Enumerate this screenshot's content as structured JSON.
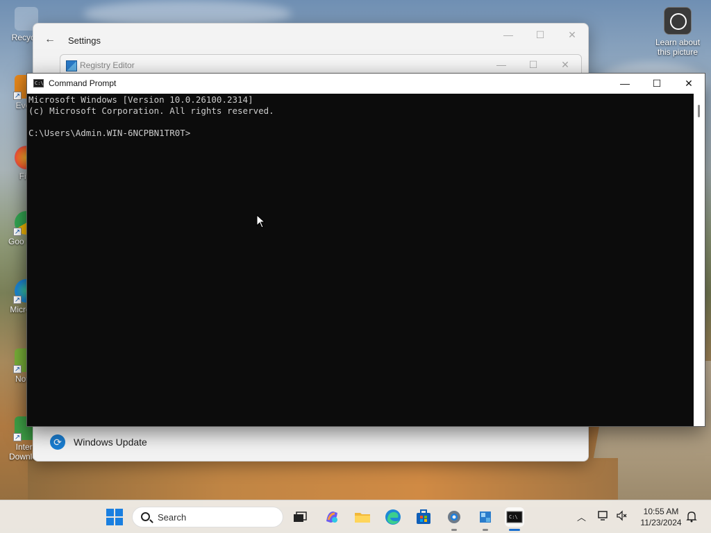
{
  "desktop": {
    "icons": [
      {
        "label": "Recycle",
        "icon": "recycle-bin-icon"
      },
      {
        "label": "Every",
        "icon": "everything-icon"
      },
      {
        "label": "Fire",
        "icon": "firefox-icon"
      },
      {
        "label": "Goo Chro",
        "icon": "chrome-icon"
      },
      {
        "label": "Micro Ed",
        "icon": "edge-icon"
      },
      {
        "label": "Notep",
        "icon": "notepad-icon"
      },
      {
        "label": "Intern Downlo...",
        "icon": "idm-icon"
      }
    ],
    "learn": {
      "label": "Learn about this picture",
      "icon": "learn-about-picture-icon"
    }
  },
  "settings_window": {
    "title": "Settings",
    "windows_update_label": "Windows Update"
  },
  "regedit_window": {
    "title": "Registry Editor"
  },
  "cmd_window": {
    "title": "Command Prompt",
    "lines": [
      "Microsoft Windows [Version 10.0.26100.2314]",
      "(c) Microsoft Corporation. All rights reserved.",
      "",
      "C:\\Users\\Admin.WIN-6NCPBN1TR0T>"
    ]
  },
  "taskbar": {
    "search_placeholder": "Search",
    "apps": [
      {
        "name": "task-view",
        "icon": "task-view-icon",
        "active": false
      },
      {
        "name": "copilot",
        "icon": "copilot-icon",
        "active": false
      },
      {
        "name": "file-explorer",
        "icon": "file-explorer-icon",
        "active": false
      },
      {
        "name": "edge",
        "icon": "edge-icon",
        "active": false
      },
      {
        "name": "microsoft-store",
        "icon": "store-icon",
        "active": false
      },
      {
        "name": "settings",
        "icon": "settings-gear-icon",
        "active": false
      },
      {
        "name": "registry-editor",
        "icon": "regedit-icon",
        "active": false
      },
      {
        "name": "command-prompt",
        "icon": "cmd-icon",
        "active": true
      }
    ],
    "time": "10:55 AM",
    "date": "11/23/2024"
  },
  "colors": {
    "console_bg": "#0c0c0c",
    "console_fg": "#cccccc",
    "accent": "#1a7fe0"
  }
}
